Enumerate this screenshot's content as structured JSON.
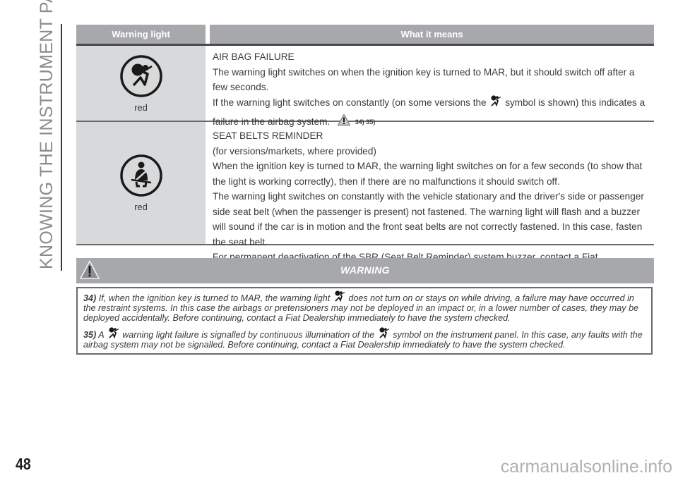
{
  "section_title": "KNOWING THE INSTRUMENT PANEL",
  "table": {
    "headers": [
      "Warning light",
      "What it means"
    ],
    "rows": [
      {
        "icon": "airbag-warning-icon",
        "color_label": "red",
        "title": "AIR BAG FAILURE",
        "line1": "The warning light switches on when the ignition key is turned to MAR, but it should switch off after a few seconds.",
        "line2_pre": "If the warning light switches on constantly (on some versions the",
        "line2_post": "symbol is shown) this indicates a",
        "line3": "failure in the airbag system.",
        "refs": "34) 35)"
      },
      {
        "icon": "seat-belt-warning-icon",
        "color_label": "red",
        "title": "SEAT BELTS REMINDER",
        "lines": [
          "(for versions/markets, where provided)",
          "When the ignition key is turned to MAR, the warning light switches on for a few seconds (to show that the light is working correctly), then if there are no malfunctions it should switch off.",
          "The warning light switches on constantly with the vehicle stationary and the driver's side or passenger side seat belt (when the passenger is present) not fastened. The warning light will flash and a buzzer will sound if the car is in motion and the front seat belts are not correctly fastened. In this case, fasten the seat belt.",
          "For permanent deactivation of the SBR (Seat Belt Reminder) system buzzer, contact a Fiat Dealership. The system can be reactivated at any time using the Setup Menu."
        ]
      }
    ]
  },
  "warning": {
    "title": "WARNING",
    "notes": [
      {
        "num": "34)",
        "pre": "If, when the ignition key is turned to MAR, the warning light",
        "post": "does not turn on or stays on while driving, a failure may have occurred in the restraint systems. In this case the airbags or pretensioners may not be deployed in an impact or, in a lower number of cases, they may be deployed accidentally. Before continuing, contact a Fiat Dealership immediately to have the system checked."
      },
      {
        "num": "35)",
        "pre": "A",
        "mid": "warning light failure is signalled by continuous illumination of the",
        "post": "symbol on the instrument panel. In this case, any faults with the airbag system may not be signalled. Before continuing, contact a Fiat Dealership immediately to have the system checked."
      }
    ]
  },
  "footer": {
    "page_number": "48",
    "watermark": "carmanualsonline.info"
  },
  "colors": {
    "header_gray": "#a7a8ab",
    "icon_cell_gray": "#d8d9da",
    "text": "#3a3a3a"
  }
}
